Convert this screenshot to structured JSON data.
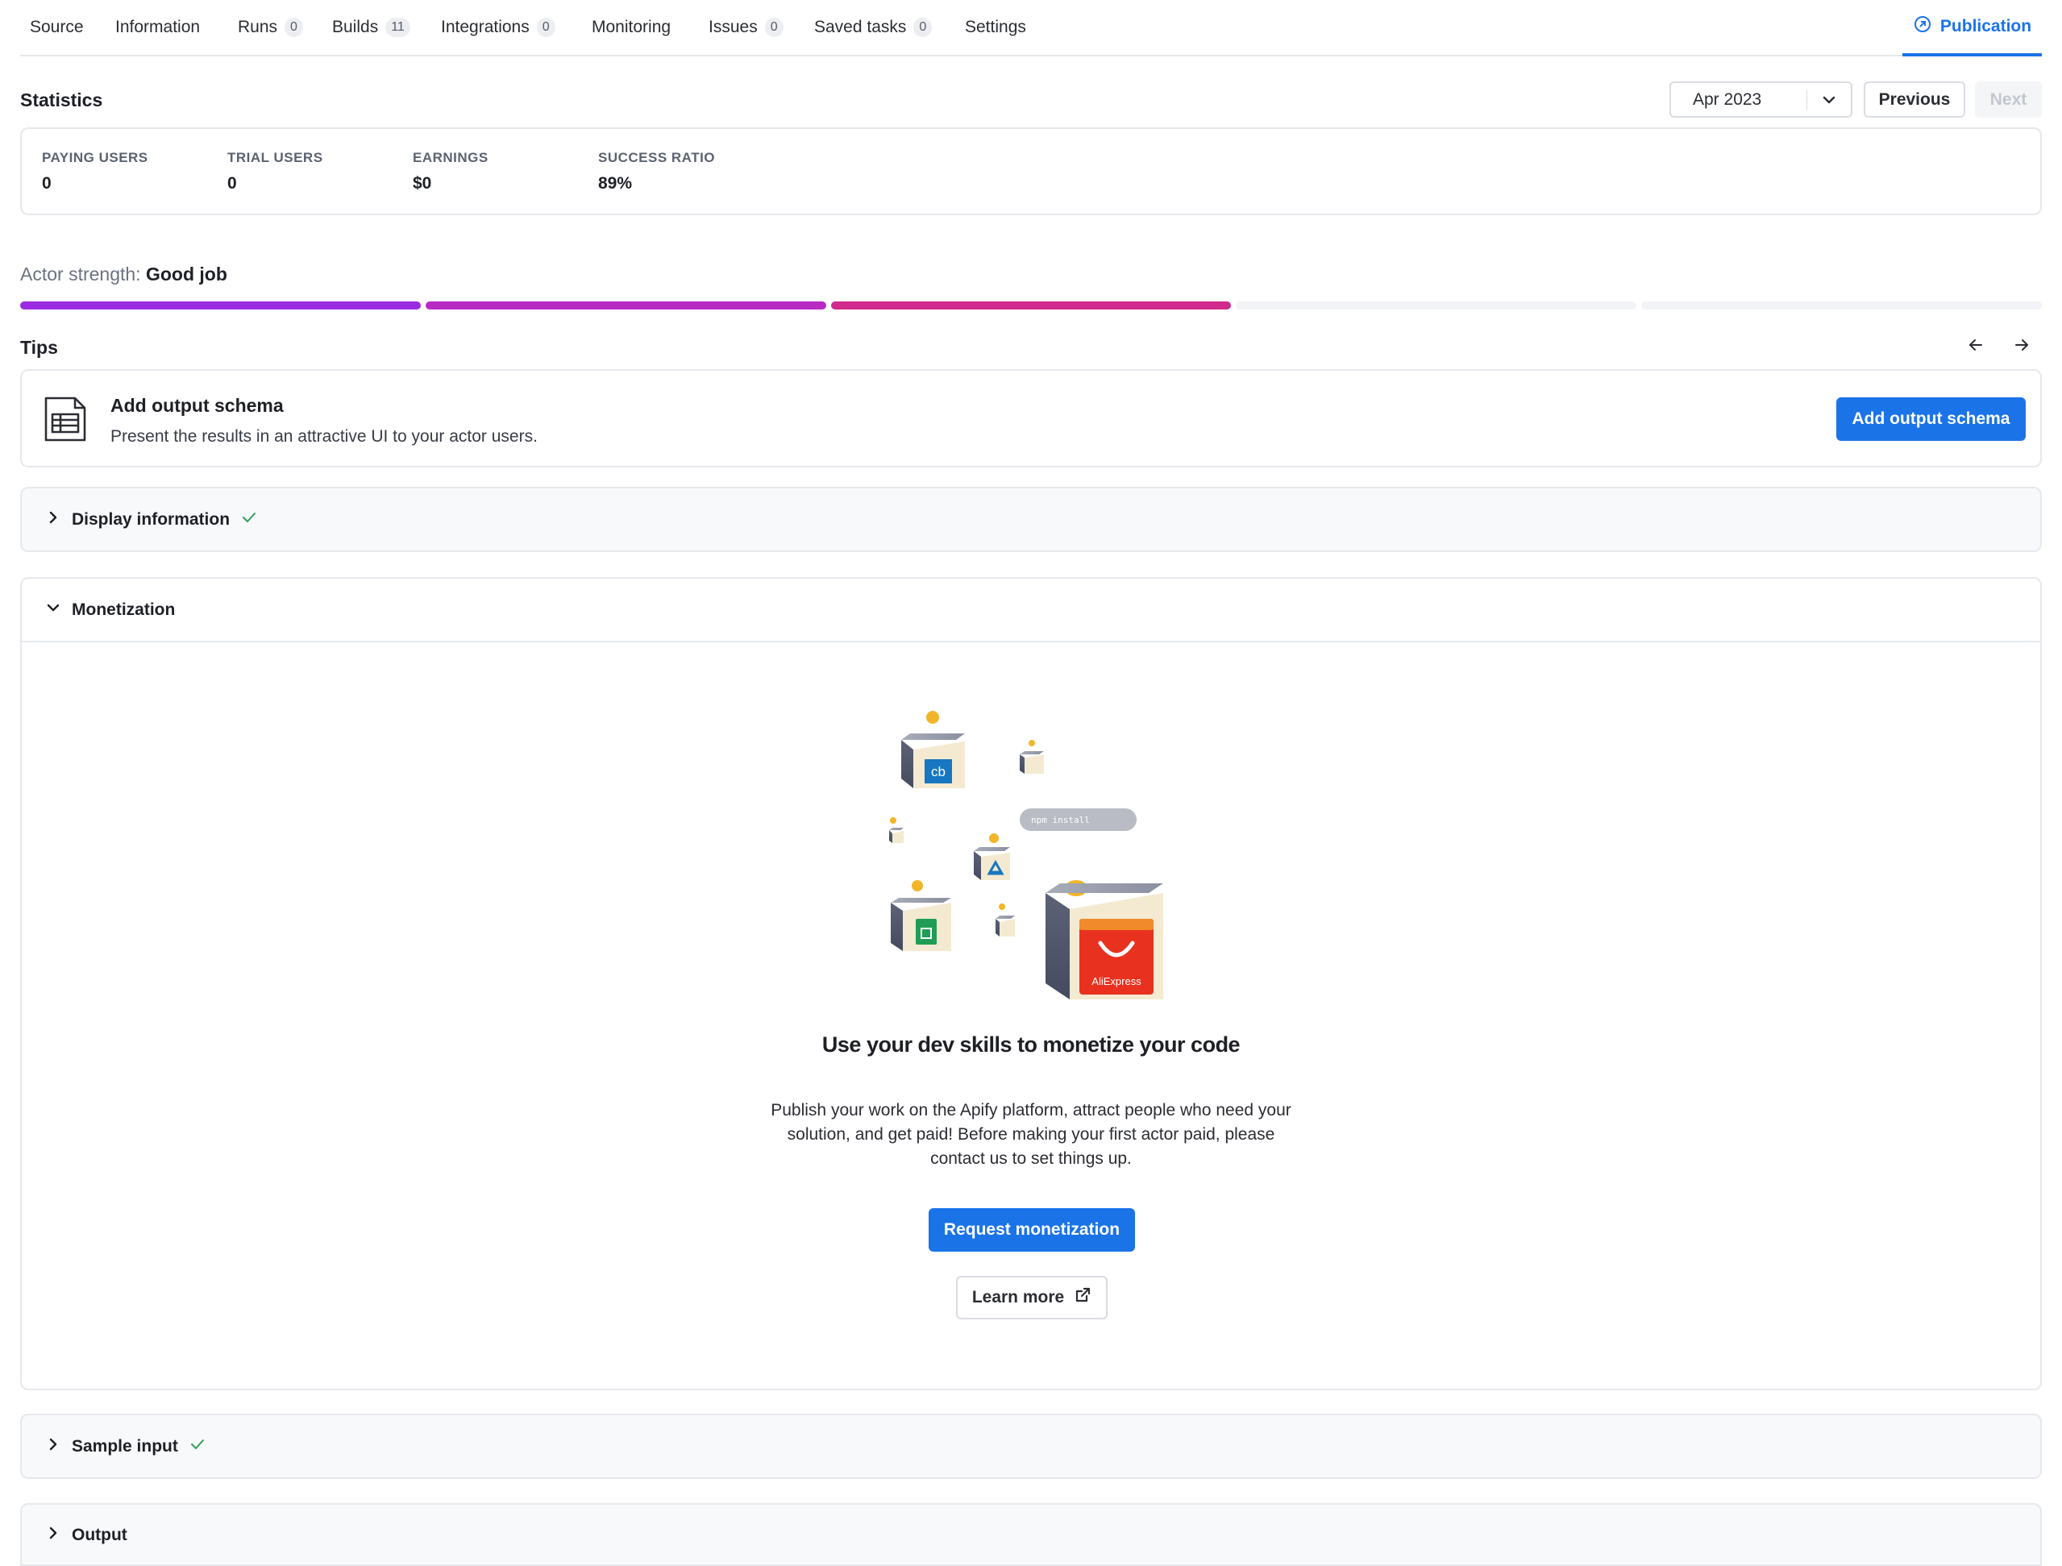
{
  "tabs": [
    {
      "label": "Source"
    },
    {
      "label": "Information"
    },
    {
      "label": "Runs",
      "count": "0"
    },
    {
      "label": "Builds",
      "count": "11"
    },
    {
      "label": "Integrations",
      "count": "0"
    },
    {
      "label": "Monitoring"
    },
    {
      "label": "Issues",
      "count": "0"
    },
    {
      "label": "Saved tasks",
      "count": "0"
    },
    {
      "label": "Settings"
    }
  ],
  "active_tab": {
    "label": "Publication",
    "icon": "publish-icon"
  },
  "statistics": {
    "title": "Statistics",
    "month": "Apr 2023",
    "previous_label": "Previous",
    "next_label": "Next",
    "items": [
      {
        "label": "PAYING USERS",
        "value": "0"
      },
      {
        "label": "TRIAL USERS",
        "value": "0"
      },
      {
        "label": "EARNINGS",
        "value": "$0"
      },
      {
        "label": "SUCCESS RATIO",
        "value": "89%"
      }
    ]
  },
  "strength": {
    "label": "Actor strength:",
    "value": "Good job",
    "segments_total": 5,
    "segments_filled": 3,
    "colors": [
      "#9b2be0",
      "#b72ac4",
      "#cf2a8c"
    ]
  },
  "tips": {
    "title": "Tips",
    "card": {
      "title": "Add output schema",
      "description": "Present the results in an attractive UI to your actor users.",
      "button": "Add output schema",
      "icon": "table-schema-icon"
    }
  },
  "sections": {
    "display_information": {
      "label": "Display information",
      "complete": true
    },
    "monetization": {
      "label": "Monetization",
      "heading": "Use your dev skills to monetize your code",
      "description": "Publish your work on the Apify platform, attract people who need your solution, and get paid! Before making your first actor paid, please contact us to set things up.",
      "primary_button": "Request monetization",
      "secondary_button": "Learn more",
      "illustration": {
        "npm_text": "npm install",
        "cb_text": "cb",
        "brand_text": "AliExpress"
      }
    },
    "sample_input": {
      "label": "Sample input",
      "complete": true
    },
    "output": {
      "label": "Output",
      "complete": false
    }
  },
  "colors": {
    "accent": "#1b73e8",
    "check": "#2e9e55",
    "border": "#e6e8ed"
  }
}
